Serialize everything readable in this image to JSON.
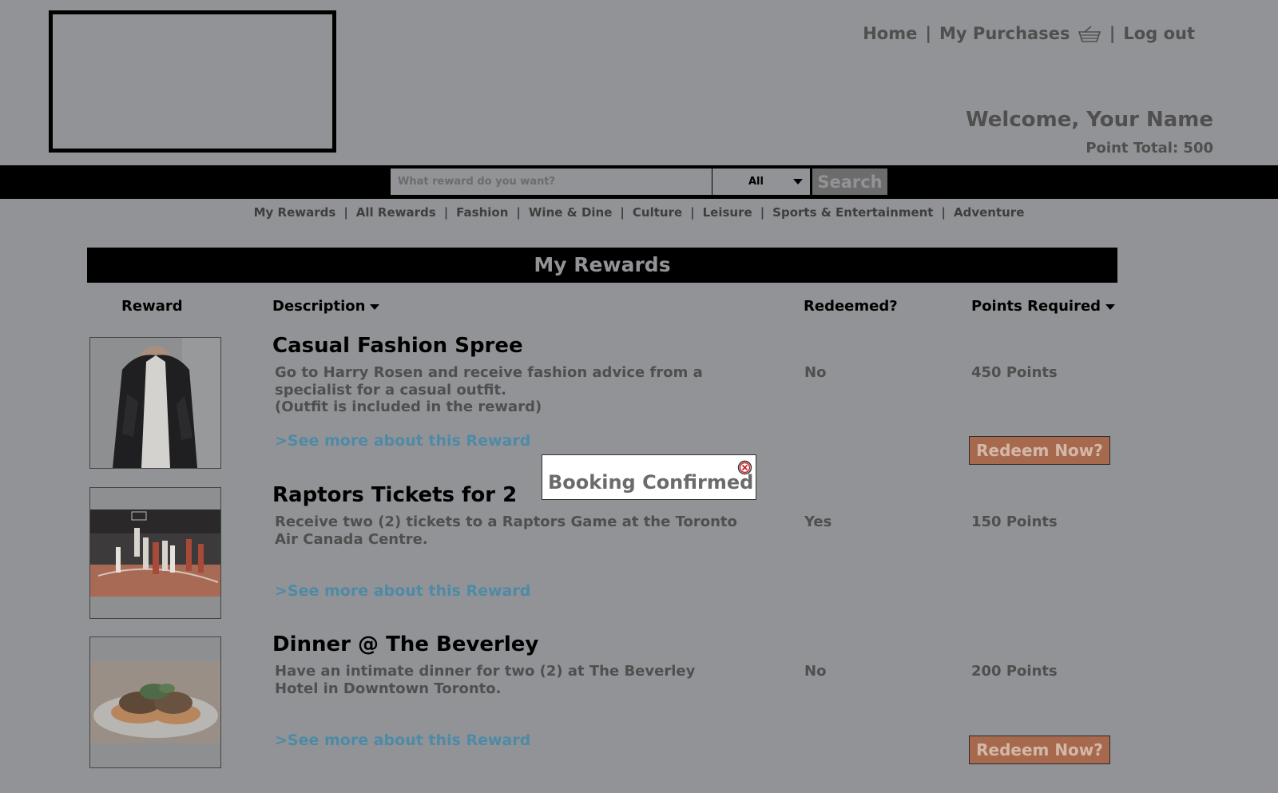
{
  "header": {
    "nav": {
      "home": "Home",
      "purchases": "My Purchases",
      "logout": "Log out",
      "separator": "|"
    },
    "welcome": "Welcome, Your Name",
    "point_total": "Point Total: 500"
  },
  "search": {
    "placeholder": "What reward do you want?",
    "category_selected": "All",
    "button_label": "Search"
  },
  "categories": [
    "My Rewards",
    "All Rewards",
    "Fashion",
    "Wine & Dine",
    "Culture",
    "Leisure",
    "Sports & Entertainment",
    "Adventure"
  ],
  "section_title": "My Rewards",
  "columns": {
    "reward": "Reward",
    "description": "Description",
    "redeemed": "Redeemed?",
    "points": "Points Required"
  },
  "rewards": [
    {
      "title": "Casual Fashion Spree",
      "description": "Go to Harry Rosen and receive fashion advice from a\nspecialist for a casual outfit.\n(Outfit is included in the reward)",
      "link": ">See more about this Reward",
      "redeemed": "No",
      "points": "450 Points",
      "action": "Redeem Now?",
      "image": "man-in-blazer-photo"
    },
    {
      "title": "Raptors Tickets for 2",
      "description": "Receive two (2) tickets to a Raptors Game at the Toronto\nAir Canada Centre.",
      "link": ">See more about this Reward",
      "redeemed": "Yes",
      "points": "150 Points",
      "image": "basketball-game-photo"
    },
    {
      "title": "Dinner @ The Beverley",
      "description": "Have an intimate dinner for two (2) at The Beverley\nHotel in Downtown Toronto.",
      "link": ">See more about this Reward",
      "redeemed": "No",
      "points": "200 Points",
      "action": "Redeem Now?",
      "image": "plated-dinner-photo"
    }
  ],
  "modal": {
    "message": "Booking Confirmed",
    "close_icon": "close-circle-icon"
  },
  "colors": {
    "background": "#929396",
    "bar": "#000000",
    "link": "#4e8aa6",
    "redeem_button": "#a6694e",
    "close_icon": "#cc2222"
  }
}
